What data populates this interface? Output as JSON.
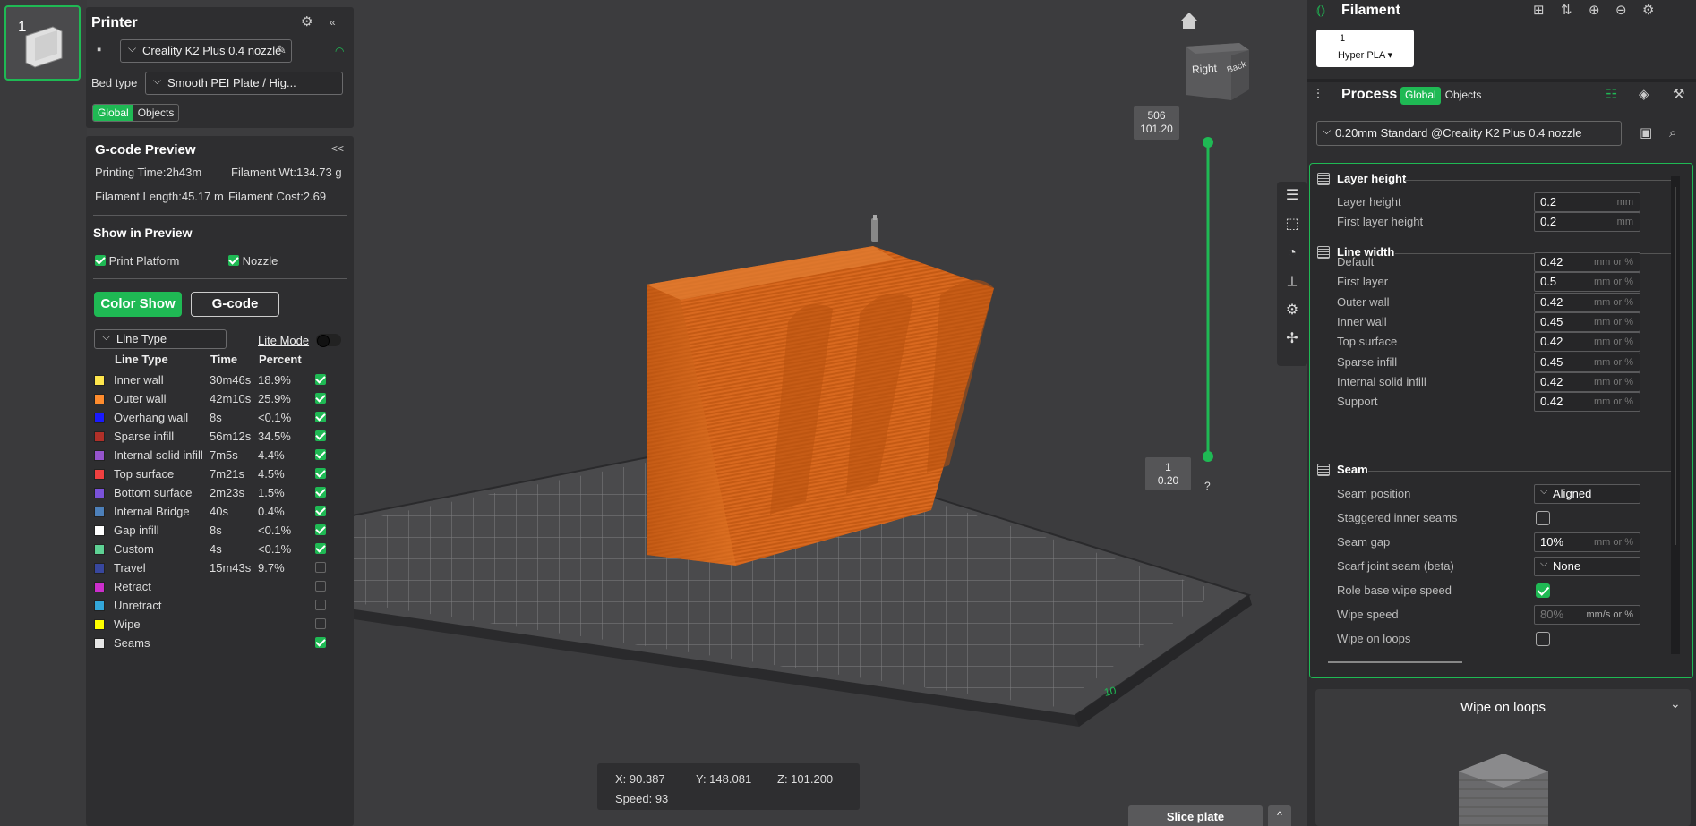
{
  "plate": {
    "number": "1"
  },
  "printer": {
    "title": "Printer",
    "name": "Creality K2 Plus 0.4 nozzle",
    "bed_type_label": "Bed type",
    "bed_type": "Smooth PEI Plate / Hig...",
    "scope_tabs": [
      "Global",
      "Objects"
    ]
  },
  "gcode_preview": {
    "title": "G-code Preview",
    "collapse": "<<",
    "printing_time": "Printing Time:2h43m",
    "filament_wt": "Filament Wt:134.73 g",
    "filament_length": "Filament Length:45.17 m",
    "filament_cost": "Filament Cost:2.69",
    "show_title": "Show in Preview",
    "print_platform": "Print Platform",
    "nozzle": "Nozzle",
    "color_show": "Color Show",
    "gcode_btn": "G-code",
    "view_type": "Line Type",
    "lite_mode": "Lite Mode",
    "columns": [
      "Line Type",
      "Time",
      "Percent"
    ],
    "rows": [
      {
        "name": "Inner wall",
        "time": "30m46s",
        "pct": "18.9%",
        "color": "#ffe64d",
        "checked": true
      },
      {
        "name": "Outer wall",
        "time": "42m10s",
        "pct": "25.9%",
        "color": "#ff8c2e",
        "checked": true
      },
      {
        "name": "Overhang wall",
        "time": "8s",
        "pct": "<0.1%",
        "color": "#1a1aff",
        "checked": true
      },
      {
        "name": "Sparse infill",
        "time": "56m12s",
        "pct": "34.5%",
        "color": "#b03029",
        "checked": true
      },
      {
        "name": "Internal solid infill",
        "time": "7m5s",
        "pct": "4.4%",
        "color": "#9654cc",
        "checked": true
      },
      {
        "name": "Top surface",
        "time": "7m21s",
        "pct": "4.5%",
        "color": "#f04040",
        "checked": true
      },
      {
        "name": "Bottom surface",
        "time": "2m23s",
        "pct": "1.5%",
        "color": "#7a52d9",
        "checked": true
      },
      {
        "name": "Internal Bridge",
        "time": "40s",
        "pct": "0.4%",
        "color": "#4d80ba",
        "checked": true
      },
      {
        "name": "Gap infill",
        "time": "8s",
        "pct": "<0.1%",
        "color": "#ffffff",
        "checked": true
      },
      {
        "name": "Custom",
        "time": "4s",
        "pct": "<0.1%",
        "color": "#5ed194",
        "checked": true
      },
      {
        "name": "Travel",
        "time": "15m43s",
        "pct": "9.7%",
        "color": "#38479e",
        "checked": false
      },
      {
        "name": "Retract",
        "time": "",
        "pct": "",
        "color": "#cc2ecc",
        "checked": false
      },
      {
        "name": "Unretract",
        "time": "",
        "pct": "",
        "color": "#33a6d9",
        "checked": false
      },
      {
        "name": "Wipe",
        "time": "",
        "pct": "",
        "color": "#ffff00",
        "checked": false
      },
      {
        "name": "Seams",
        "time": "",
        "pct": "",
        "color": "#e6e6e6",
        "checked": true
      }
    ]
  },
  "layer_slider": {
    "top_layer": "506",
    "top_height": "101.20",
    "bottom_layer": "1",
    "bottom_height": "0.20",
    "help": "?"
  },
  "view_cube": {
    "right": "Right",
    "back": "Back"
  },
  "coords": {
    "x": "X: 90.387",
    "y": "Y: 148.081",
    "z": "Z: 101.200",
    "speed": "Speed: 93"
  },
  "slice_plate": "Slice plate",
  "slice_caret": "^",
  "filament": {
    "title": "Filament",
    "slot": "1",
    "type": "Hyper PLA ▾"
  },
  "process": {
    "title": "Process",
    "tabs": [
      "Global",
      "Objects"
    ],
    "preset": "0.20mm Standard @Creality K2 Plus 0.4 nozzle"
  },
  "settings": {
    "layer_height": {
      "title": "Layer height",
      "items": [
        {
          "label": "Layer height",
          "value": "0.2",
          "unit": "mm"
        },
        {
          "label": "First layer height",
          "value": "0.2",
          "unit": "mm"
        }
      ]
    },
    "line_width": {
      "title": "Line width",
      "items": [
        {
          "label": "Default",
          "value": "0.42",
          "unit": "mm or %"
        },
        {
          "label": "First layer",
          "value": "0.5",
          "unit": "mm or %"
        },
        {
          "label": "Outer wall",
          "value": "0.42",
          "unit": "mm or %"
        },
        {
          "label": "Inner wall",
          "value": "0.45",
          "unit": "mm or %"
        },
        {
          "label": "Top surface",
          "value": "0.42",
          "unit": "mm or %"
        },
        {
          "label": "Sparse infill",
          "value": "0.45",
          "unit": "mm or %"
        },
        {
          "label": "Internal solid infill",
          "value": "0.42",
          "unit": "mm or %"
        },
        {
          "label": "Support",
          "value": "0.42",
          "unit": "mm or %"
        }
      ]
    },
    "seam": {
      "title": "Seam",
      "seam_position": {
        "label": "Seam position",
        "value": "Aligned"
      },
      "staggered": {
        "label": "Staggered inner seams",
        "checked": false
      },
      "seam_gap": {
        "label": "Seam gap",
        "value": "10%",
        "unit": "mm or %"
      },
      "scarf": {
        "label": "Scarf joint seam (beta)",
        "value": "None"
      },
      "role_wipe": {
        "label": "Role base wipe speed",
        "checked": true
      },
      "wipe_speed": {
        "label": "Wipe speed",
        "value": "80%",
        "unit": "mm/s or %"
      },
      "wipe_loops": {
        "label": "Wipe on loops",
        "checked": false
      }
    }
  },
  "help_panel": {
    "title": "Wipe on loops",
    "chevron": "⌄"
  },
  "colors": {
    "accent": "#1fb954",
    "model": "#d9691f"
  }
}
